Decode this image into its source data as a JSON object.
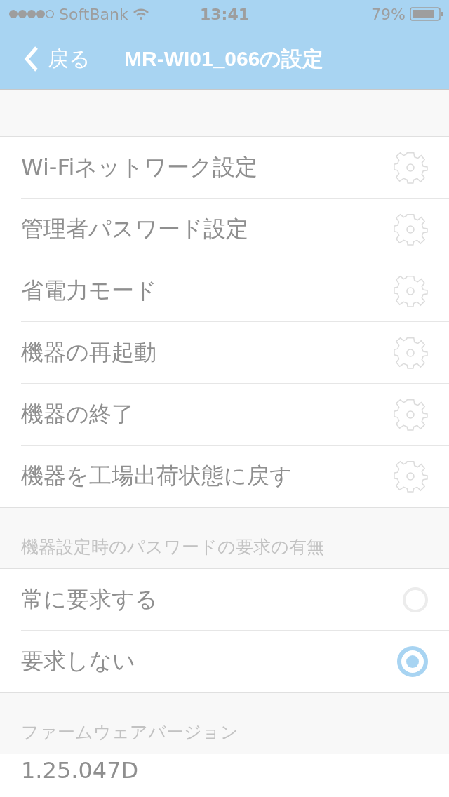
{
  "status_bar": {
    "carrier": "SoftBank",
    "time": "13:41",
    "battery": "79%"
  },
  "nav_bar": {
    "back": "戻る",
    "title": "MR-WI01_066の設定"
  },
  "settings": [
    {
      "label": "Wi-Fiネットワーク設定"
    },
    {
      "label": "管理者パスワード設定"
    },
    {
      "label": "省電力モード"
    },
    {
      "label": "機器の再起動"
    },
    {
      "label": "機器の終了"
    },
    {
      "label": "機器を工場出荷状態に戻す"
    }
  ],
  "password_section": {
    "header": "機器設定時のパスワードの要求の有無",
    "options": [
      {
        "label": "常に要求する",
        "selected": false
      },
      {
        "label": "要求しない",
        "selected": true
      }
    ]
  },
  "firmware_section": {
    "header": "ファームウェアバージョン",
    "version": "1.25.047D"
  }
}
